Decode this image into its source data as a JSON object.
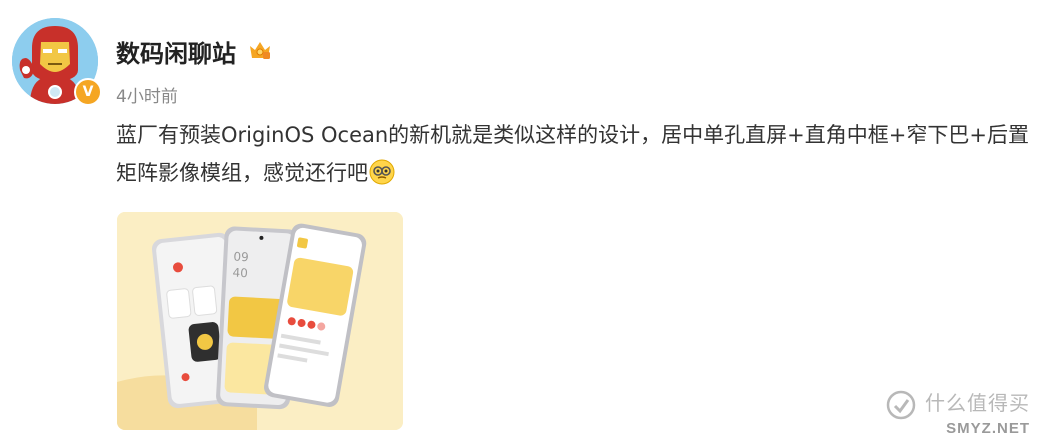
{
  "post": {
    "username": "数码闲聊站",
    "timestamp": "4小时前",
    "content": "蓝厂有预装OriginOS Ocean的新机就是类似这样的设计，居中单孔直屏+直角中框+窄下巴+后置矩阵影像模组，感觉还行吧",
    "emoji_icon": "thinking-face-icon",
    "verified_icon": "verified-v-icon",
    "crown_icon": "crown-badge-icon"
  },
  "image": {
    "time_display": [
      "09",
      "40"
    ]
  },
  "watermark": {
    "text": "什么值得买",
    "site": "SMYZ.NET"
  },
  "colors": {
    "verified": "#f5a623",
    "image_bg": "#fbeec4",
    "text": "#333333",
    "meta": "#888888"
  }
}
